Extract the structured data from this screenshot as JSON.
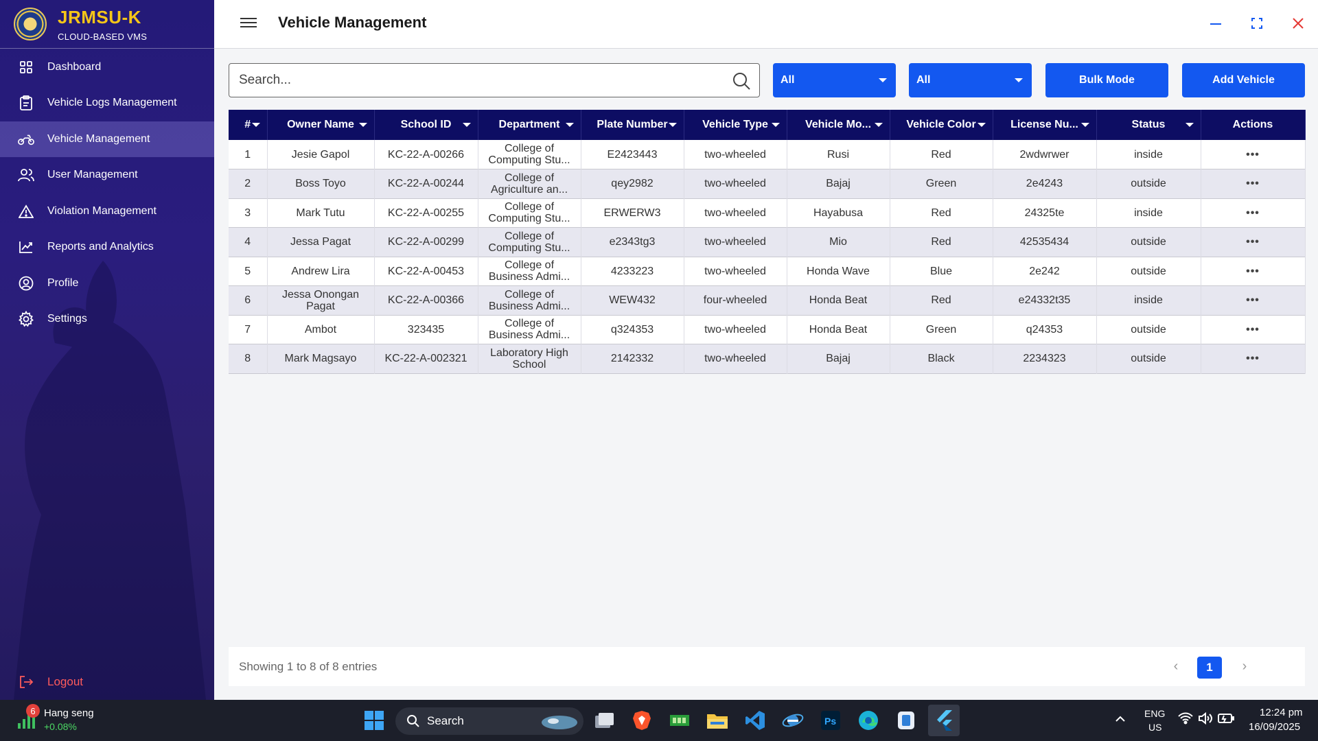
{
  "brand": {
    "title": "JRMSU-K",
    "subtitle": "CLOUD-BASED VMS"
  },
  "sidebar": {
    "items": [
      {
        "label": "Dashboard",
        "icon": "dashboard-icon"
      },
      {
        "label": "Vehicle Logs Management",
        "icon": "clipboard-icon"
      },
      {
        "label": "Vehicle Management",
        "icon": "motorcycle-icon",
        "active": true
      },
      {
        "label": "User Management",
        "icon": "users-icon"
      },
      {
        "label": "Violation Management",
        "icon": "warning-icon"
      },
      {
        "label": "Reports and Analytics",
        "icon": "chart-icon"
      },
      {
        "label": "Profile",
        "icon": "profile-icon"
      },
      {
        "label": "Settings",
        "icon": "gear-icon"
      }
    ],
    "logout": "Logout"
  },
  "header": {
    "title": "Vehicle Management"
  },
  "toolbar": {
    "search_placeholder": "Search...",
    "filter1": "All",
    "filter2": "All",
    "bulk_label": "Bulk Mode",
    "add_label": "Add Vehicle"
  },
  "table": {
    "headers": [
      "#",
      "Owner Name",
      "School ID",
      "Department",
      "Plate Number",
      "Vehicle Type",
      "Vehicle Mo...",
      "Vehicle Color",
      "License Nu...",
      "Status",
      "Actions"
    ],
    "rows": [
      [
        "1",
        "Jesie Gapol",
        "KC-22-A-00266",
        "College of Computing Stu...",
        "E2423443",
        "two-wheeled",
        "Rusi",
        "Red",
        "2wdwrwer",
        "inside"
      ],
      [
        "2",
        "Boss Toyo",
        "KC-22-A-00244",
        "College of Agriculture an...",
        "qey2982",
        "two-wheeled",
        "Bajaj",
        "Green",
        "2e4243",
        "outside"
      ],
      [
        "3",
        "Mark Tutu",
        "KC-22-A-00255",
        "College of Computing Stu...",
        "ERWERW3",
        "two-wheeled",
        "Hayabusa",
        "Red",
        "24325te",
        "inside"
      ],
      [
        "4",
        "Jessa Pagat",
        "KC-22-A-00299",
        "College of Computing Stu...",
        "e2343tg3",
        "two-wheeled",
        "Mio",
        "Red",
        "42535434",
        "outside"
      ],
      [
        "5",
        "Andrew Lira",
        "KC-22-A-00453",
        "College of Business Admi...",
        "4233223",
        "two-wheeled",
        "Honda Wave",
        "Blue",
        "2e242",
        "outside"
      ],
      [
        "6",
        "Jessa Onongan Pagat",
        "KC-22-A-00366",
        "College of Business Admi...",
        "WEW432",
        "four-wheeled",
        "Honda Beat",
        "Red",
        "e24332t35",
        "inside"
      ],
      [
        "7",
        "Ambot",
        "323435",
        "College of Business Admi...",
        "q324353",
        "two-wheeled",
        "Honda Beat",
        "Green",
        "q24353",
        "outside"
      ],
      [
        "8",
        "Mark Magsayo",
        "KC-22-A-002321",
        "Laboratory High School",
        "2142332",
        "two-wheeled",
        "Bajaj",
        "Black",
        "2234323",
        "outside"
      ]
    ],
    "actions_glyph": "•••"
  },
  "footer": {
    "entries": "Showing 1 to 8 of 8 entries",
    "page": "1"
  },
  "taskbar": {
    "widget_name": "Hang seng",
    "widget_change": "+0.08%",
    "widget_badge": "6",
    "search_label": "Search",
    "lang1": "ENG",
    "lang2": "US",
    "time": "12:24 pm",
    "date": "16/09/2025"
  },
  "colors": {
    "accent": "#1358f0",
    "sidebar": "#241a78",
    "table_header": "#0d0d63",
    "brand": "#f5c518",
    "logout": "#ff5b5b"
  }
}
